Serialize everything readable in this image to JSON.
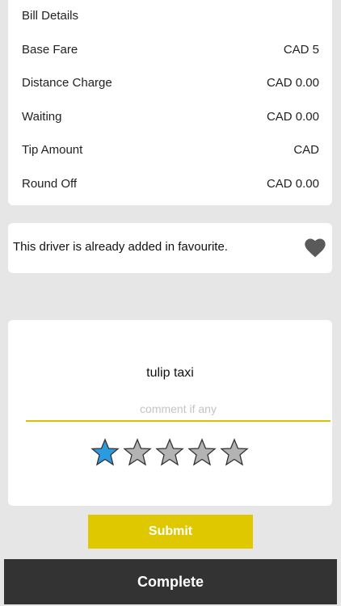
{
  "bill": {
    "title": "Bill Details",
    "rows": [
      {
        "label": "Base Fare",
        "value": "CAD 5"
      },
      {
        "label": "Distance Charge",
        "value": "CAD 0.00"
      },
      {
        "label": "Waiting",
        "value": "CAD 0.00"
      },
      {
        "label": "Tip Amount",
        "value": "CAD"
      },
      {
        "label": "Round Off",
        "value": "CAD 0.00"
      }
    ]
  },
  "favourite": {
    "message": "This driver is already added in favourite.",
    "icon": "heart-icon",
    "icon_color": "#5a5a5a"
  },
  "rating": {
    "driver_name": "tulip taxi",
    "comment_placeholder": "comment if any",
    "comment_value": "",
    "stars_total": 5,
    "stars_selected": 1,
    "star_active_color": "#2b9be0",
    "star_inactive_color": "#b3b3b3"
  },
  "actions": {
    "submit_label": "Submit",
    "complete_label": "Complete",
    "submit_color": "#dfc800",
    "complete_color": "#333333"
  }
}
